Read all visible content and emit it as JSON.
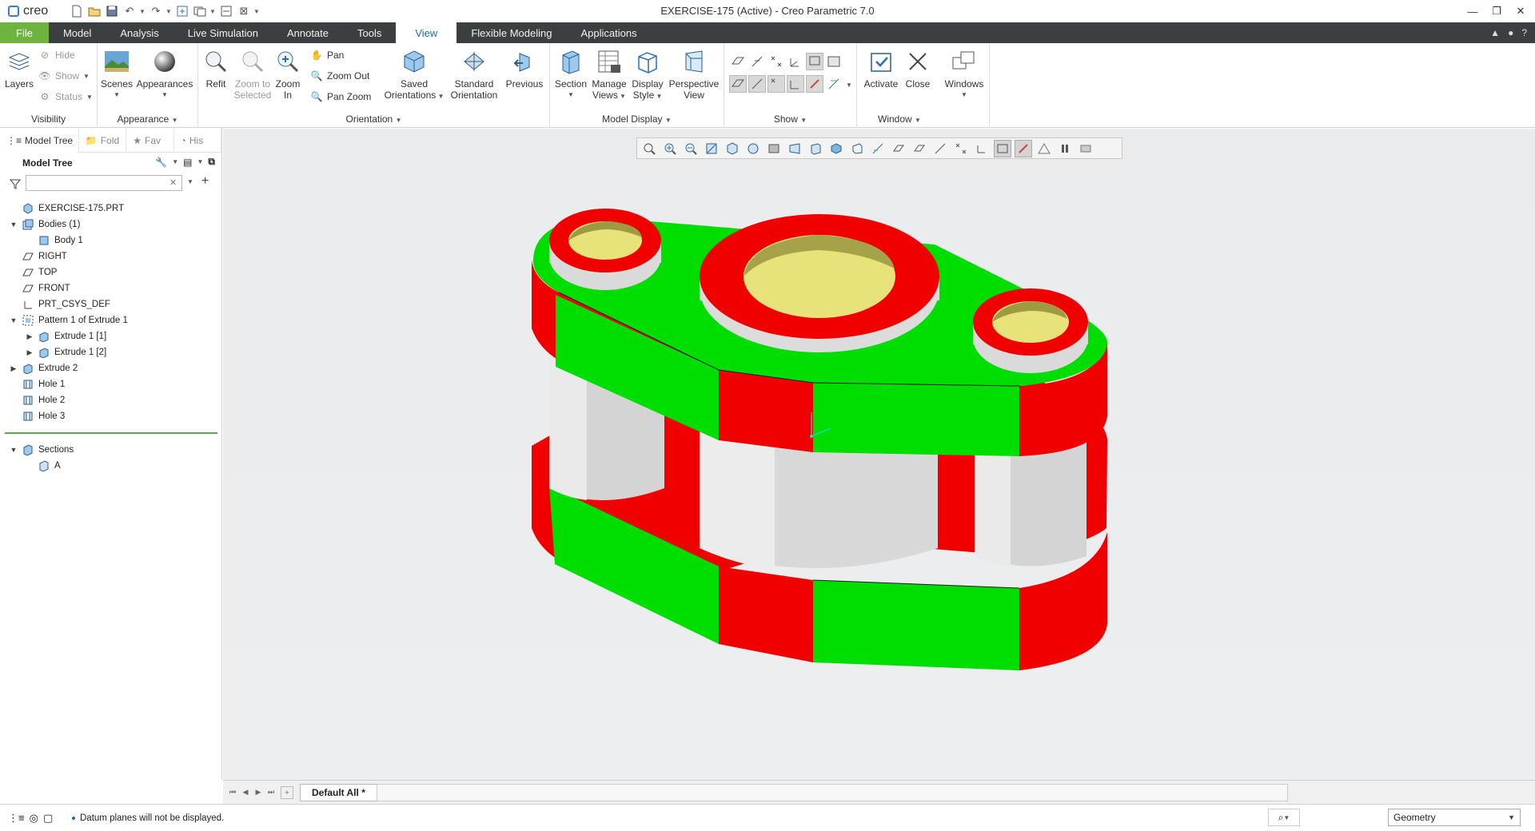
{
  "app": {
    "logo_text": "creo",
    "window_title": "EXERCISE-175 (Active) - Creo Parametric 7.0"
  },
  "tabs": [
    "File",
    "Model",
    "Analysis",
    "Live Simulation",
    "Annotate",
    "Tools",
    "View",
    "Flexible Modeling",
    "Applications"
  ],
  "ribbon": {
    "visibility": {
      "label": "Visibility",
      "layers": "Layers",
      "hide": "Hide",
      "show": "Show",
      "status": "Status"
    },
    "appearance": {
      "label": "Appearance",
      "scenes": "Scenes",
      "appearances": "Appearances"
    },
    "orientation": {
      "label": "Orientation",
      "refit": "Refit",
      "zoom_to_selected": [
        "Zoom to",
        "Selected"
      ],
      "zoom_in": [
        "Zoom",
        "In"
      ],
      "pan": "Pan",
      "zoom_out": "Zoom Out",
      "pan_zoom": "Pan Zoom",
      "saved_orientations": [
        "Saved",
        "Orientations"
      ],
      "standard_orientation": [
        "Standard",
        "Orientation"
      ],
      "previous": "Previous"
    },
    "model_display": {
      "label": "Model Display",
      "section": "Section",
      "manage_views": [
        "Manage",
        "Views"
      ],
      "display_style": [
        "Display",
        "Style"
      ],
      "perspective_view": [
        "Perspective",
        "View"
      ]
    },
    "show": {
      "label": "Show"
    },
    "window": {
      "label": "Window",
      "activate": "Activate",
      "close": "Close",
      "windows": "Windows"
    }
  },
  "panel": {
    "tabs": [
      "Model Tree",
      "Fold",
      "Fav",
      "His"
    ],
    "tree_title": "Model Tree",
    "filter_placeholder": "",
    "tree": [
      {
        "label": "EXERCISE-175.PRT",
        "level": 0,
        "expander": "",
        "icon": "part-icon"
      },
      {
        "label": "Bodies (1)",
        "level": 0,
        "expander": "▼",
        "icon": "bodies-icon"
      },
      {
        "label": "Body 1",
        "level": 1,
        "expander": "",
        "icon": "body-icon"
      },
      {
        "label": "RIGHT",
        "level": 0,
        "expander": "",
        "icon": "datum-plane-icon"
      },
      {
        "label": "TOP",
        "level": 0,
        "expander": "",
        "icon": "datum-plane-icon"
      },
      {
        "label": "FRONT",
        "level": 0,
        "expander": "",
        "icon": "datum-plane-icon"
      },
      {
        "label": "PRT_CSYS_DEF",
        "level": 0,
        "expander": "",
        "icon": "csys-icon"
      },
      {
        "label": "Pattern 1 of Extrude 1",
        "level": 0,
        "expander": "▼",
        "icon": "pattern-icon"
      },
      {
        "label": "Extrude 1 [1]",
        "level": 1,
        "expander": "▶",
        "icon": "extrude-icon"
      },
      {
        "label": "Extrude 1 [2]",
        "level": 1,
        "expander": "▶",
        "icon": "extrude-icon"
      },
      {
        "label": "Extrude 2",
        "level": 0,
        "expander": "▶",
        "icon": "extrude-icon"
      },
      {
        "label": "Hole 1",
        "level": 0,
        "expander": "",
        "icon": "hole-icon"
      },
      {
        "label": "Hole 2",
        "level": 0,
        "expander": "",
        "icon": "hole-icon"
      },
      {
        "label": "Hole 3",
        "level": 0,
        "expander": "",
        "icon": "hole-icon"
      }
    ],
    "sections_tree": [
      {
        "label": "Sections",
        "level": 0,
        "expander": "▼",
        "icon": "sections-icon"
      },
      {
        "label": "A",
        "level": 1,
        "expander": "",
        "icon": "section-icon"
      }
    ]
  },
  "sheet_tab": "Default All *",
  "status": {
    "message": "Datum planes will not be displayed.",
    "selection_filter": "Geometry"
  },
  "colors": {
    "file_tab": "#6cb33f",
    "tabbar": "#3b3f42",
    "model_green": "#00dd00",
    "model_red": "#f00000",
    "hole_yellow": "#e7e27a",
    "boss_gray": "#d8d8d8"
  }
}
